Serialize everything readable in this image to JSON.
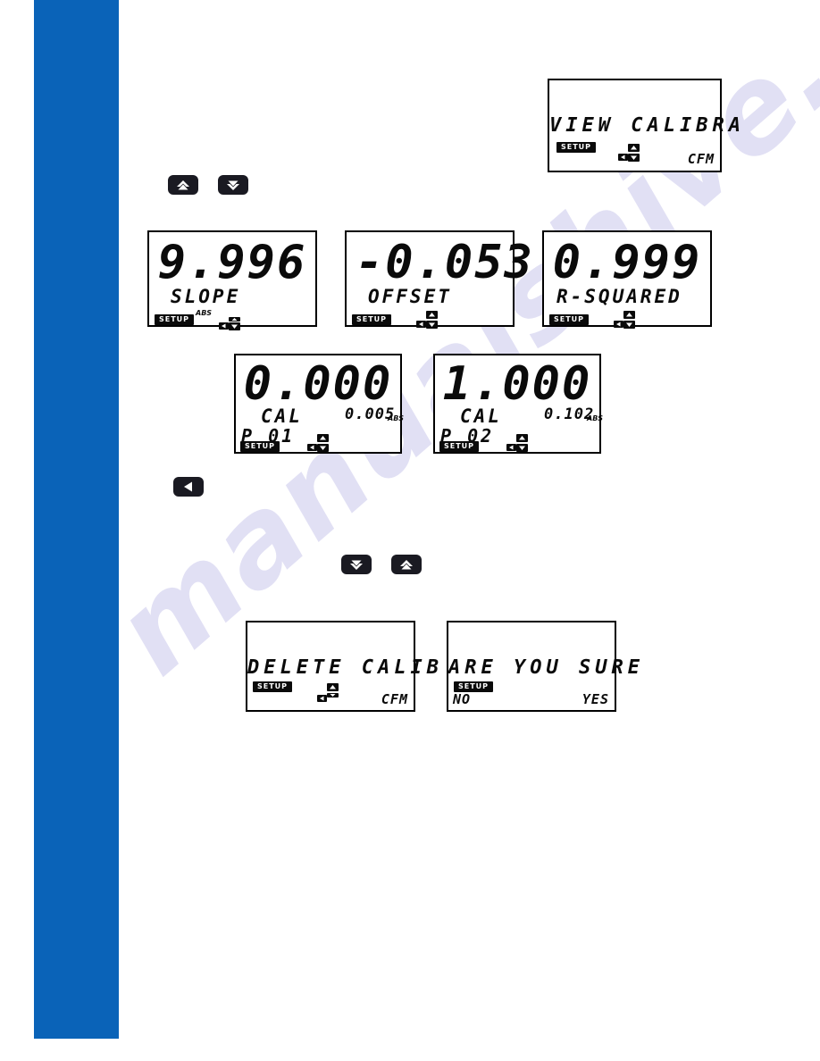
{
  "page": {
    "spine_color": "#0a63b8",
    "watermark_text": "manualshive.com"
  },
  "displays": [
    {
      "id": "view-calibration",
      "message": "VIEW CALIBRA",
      "setup_badge": "SETUP",
      "corner_right": "CFM"
    },
    {
      "id": "slope",
      "value": "9.996",
      "label": "SLOPE",
      "unit_tag": "ABS",
      "setup_badge": "SETUP"
    },
    {
      "id": "offset",
      "value": "-0.053",
      "label": "OFFSET",
      "setup_badge": "SETUP"
    },
    {
      "id": "r-squared",
      "value": "0.999",
      "label": "R-SQUARED",
      "setup_badge": "SETUP"
    },
    {
      "id": "cal-point-1",
      "value": "0.000",
      "label": "CAL",
      "secondary_value": "0.005",
      "unit_tag": "ABS",
      "point": "P 01",
      "setup_badge": "SETUP"
    },
    {
      "id": "cal-point-2",
      "value": "1.000",
      "label": "CAL",
      "secondary_value": "0.102",
      "unit_tag": "ABS",
      "point": "P 02",
      "setup_badge": "SETUP"
    },
    {
      "id": "delete-calibration",
      "message": "DELETE CALIB",
      "setup_badge": "SETUP",
      "corner_right": "CFM"
    },
    {
      "id": "are-you-sure",
      "message": "ARE YOU SURE",
      "setup_badge": "SETUP",
      "corner_left": "NO",
      "corner_right": "YES"
    }
  ],
  "buttons": {
    "up_1": "up-arrow",
    "down_1": "down-arrow",
    "back_1": "left-arrow",
    "down_2": "down-arrow",
    "up_2": "up-arrow"
  }
}
